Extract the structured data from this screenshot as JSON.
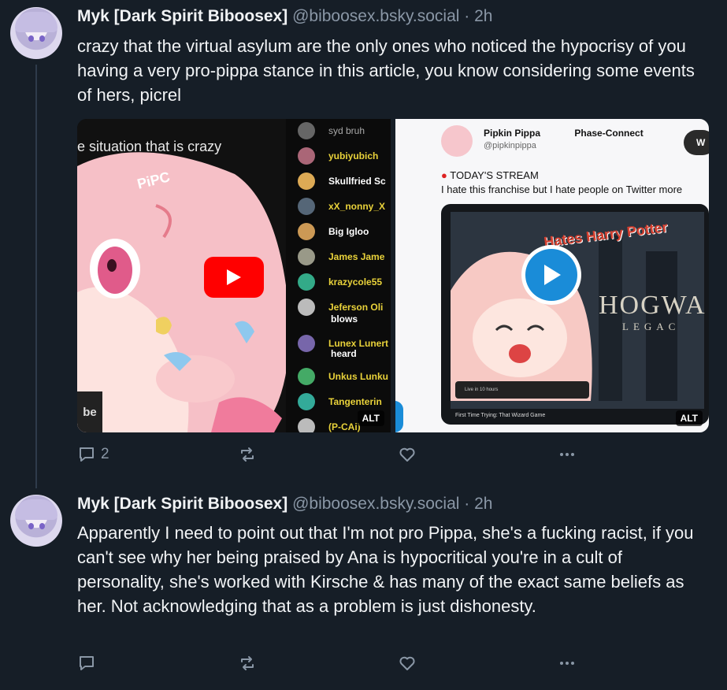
{
  "posts": [
    {
      "author": "Myk [Dark Spirit Biboosex]",
      "handle": "@biboosex.bsky.social",
      "time": "· 2h",
      "text": "crazy that the virtual asylum are the only ones who noticed the hypocrisy of you having a very pro-pippa stance in this article, you know considering some events of hers, picrel",
      "media": {
        "image1": {
          "caption": "e situation that is crazy",
          "sticker": "PiPC",
          "corner_text": "be",
          "chat_top": "syd  bruh",
          "chat": [
            "yubiyubich",
            "Skullfried Sc",
            "xX_nonny_X",
            "Big Igloo",
            "James Jame",
            "krazycole55",
            "Jeferson Oli",
            "blows",
            "Lunex Lunert",
            "heard",
            "Unkus Lunku",
            "Tangenterin",
            "(P-CAi)"
          ],
          "alt": "ALT"
        },
        "image2": {
          "tweet_name": "Pipkin Pippa",
          "tweet_org": "Phase-Connect",
          "tweet_handle": "@pipkinpippa",
          "stream_label": "TODAY'S STREAM",
          "tweet_text": "I hate this franchise but I hate people on Twitter more",
          "thumb_text": "Hates Harry Potter",
          "game_text": "HOGWA",
          "game_sub": "LEGAC",
          "footer_text": "First Time Trying: That Wizard Game",
          "live_text": "Live in 10 hours",
          "follow_btn": "W",
          "alt": "ALT"
        }
      },
      "reply_count": "2"
    },
    {
      "author": "Myk [Dark Spirit Biboosex]",
      "handle": "@biboosex.bsky.social",
      "time": "· 2h",
      "text": "Apparently I need to point out that I'm not pro Pippa, she's a fucking racist, if you can't see why her being praised by Ana is hypocritical you're in a cult of personality, she's worked with Kirsche & has many of the exact same beliefs as her. Not acknowledging that as a problem is just dishonesty.",
      "reply_count": ""
    }
  ],
  "colors": {
    "background": "#161e27",
    "muted": "#8a97a6",
    "text": "#f1f3f5",
    "thread_line": "#2e3b4b",
    "youtube_red": "#ff0000"
  },
  "icons": {
    "reply": "speech-bubble-icon",
    "repost": "repost-icon",
    "like": "heart-icon",
    "more": "ellipsis-icon",
    "play": "play-icon"
  }
}
